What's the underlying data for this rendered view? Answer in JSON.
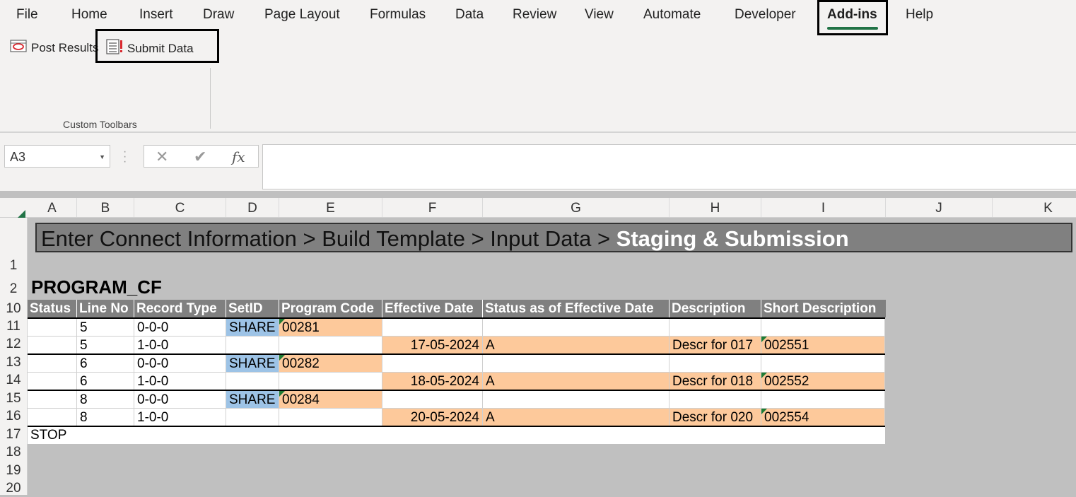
{
  "menu": {
    "tabs": [
      "File",
      "Home",
      "Insert",
      "Draw",
      "Page Layout",
      "Formulas",
      "Data",
      "Review",
      "View",
      "Automate",
      "Developer",
      "Add-ins",
      "Help"
    ],
    "active_tab": "Add-ins"
  },
  "ribbon": {
    "post_results_label": "Post Results",
    "submit_data_label": "Submit Data",
    "group_label": "Custom Toolbars"
  },
  "formula_bar": {
    "name_box": "A3",
    "fx_label": "fx",
    "formula": ""
  },
  "grid": {
    "columns": [
      "A",
      "B",
      "C",
      "D",
      "E",
      "F",
      "G",
      "H",
      "I",
      "J",
      "K"
    ],
    "rows": [
      "1",
      "2",
      "10",
      "11",
      "12",
      "13",
      "14",
      "15",
      "16",
      "17",
      "18",
      "19",
      "20"
    ],
    "banner": {
      "normal": "Enter Connect Information > Build Template > Input Data > ",
      "bold": "Staging & Submission"
    },
    "sheet_title": "PROGRAM_CF",
    "headers": [
      "Status",
      "Line No",
      "Record Type",
      "SetID",
      "Program Code",
      "Effective Date",
      "Status as of Effective Date",
      "Description",
      "Short Description"
    ],
    "data_rows": [
      [
        "",
        "5",
        "0-0-0",
        "SHARE",
        "00281",
        "",
        "",
        "",
        ""
      ],
      [
        "",
        "5",
        "1-0-0",
        "",
        "",
        "17-05-2024",
        "A",
        "Descr for 017",
        "002551"
      ],
      [
        "",
        "6",
        "0-0-0",
        "SHARE",
        "00282",
        "",
        "",
        "",
        ""
      ],
      [
        "",
        "6",
        "1-0-0",
        "",
        "",
        "18-05-2024",
        "A",
        "Descr for 018",
        "002552"
      ],
      [
        "",
        "8",
        "0-0-0",
        "SHARE",
        "00284",
        "",
        "",
        "",
        ""
      ],
      [
        "",
        "8",
        "1-0-0",
        "",
        "",
        "20-05-2024",
        "A",
        "Descr for 020",
        "002554"
      ]
    ],
    "stop_label": "STOP"
  },
  "colors": {
    "accent": "#217346",
    "header_gray": "#808080",
    "orange_fill": "#fdc99b",
    "blue_fill": "#9dc3e6"
  }
}
